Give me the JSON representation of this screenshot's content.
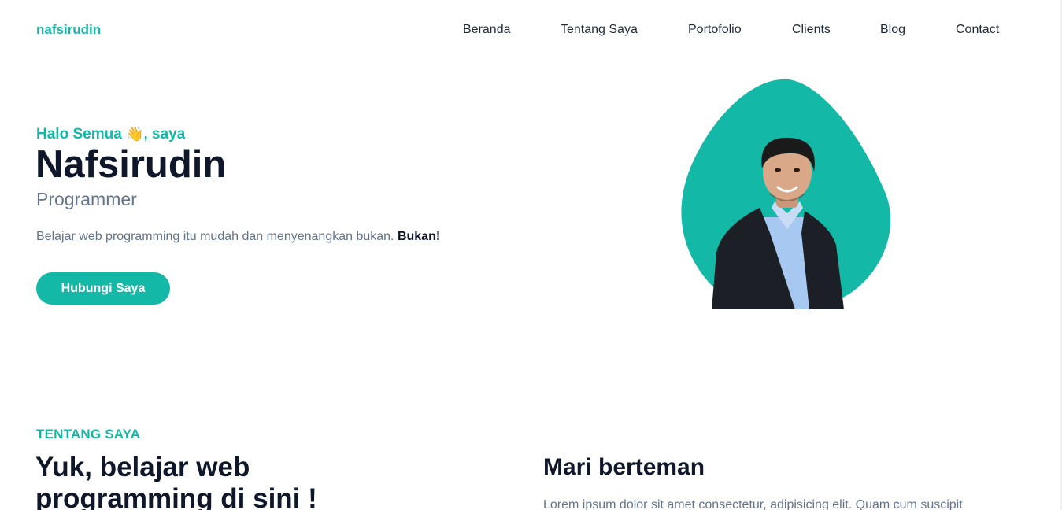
{
  "header": {
    "brand": "nafsirudin",
    "nav": [
      "Beranda",
      "Tentang Saya",
      "Portofolio",
      "Clients",
      "Blog",
      "Contact"
    ]
  },
  "hero": {
    "greeting_prefix": "Halo Semua",
    "greeting_emoji": "👋",
    "greeting_suffix": ", saya",
    "name": "Nafsirudin",
    "role": "Programmer",
    "description": "Belajar web programming itu mudah dan menyenangkan bukan.",
    "description_emphasis": "Bukan!",
    "cta_label": "Hubungi Saya",
    "portrait_icon": "person-portrait-icon"
  },
  "about": {
    "eyebrow": "TENTANG SAYA",
    "title": "Yuk, belajar web programming di sini !",
    "friend_title": "Mari berteman",
    "friend_text": "Lorem ipsum dolor sit amet consectetur, adipisicing elit. Quam cum suscipit"
  },
  "colors": {
    "accent": "#14b8a6",
    "heading": "#0f172a",
    "muted": "#64748b",
    "nav_text": "#1e293b",
    "shirt": "#a7c8f0",
    "jacket": "#1c1f26"
  }
}
